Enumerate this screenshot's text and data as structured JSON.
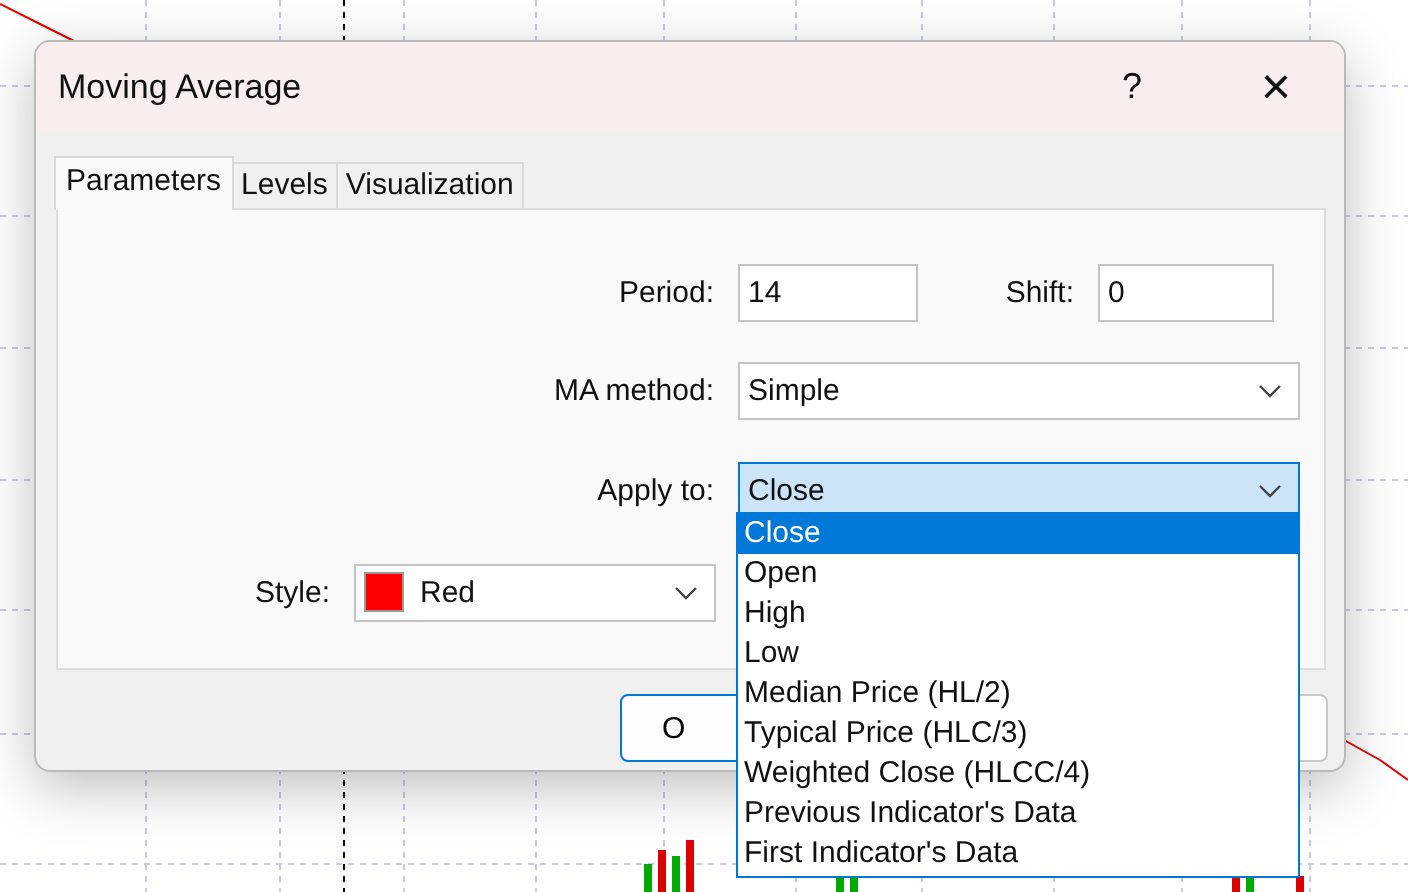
{
  "dialog": {
    "title": "Moving Average",
    "help": "?",
    "close": "×"
  },
  "tabs": [
    {
      "label": "Parameters",
      "selected": true
    },
    {
      "label": "Levels",
      "selected": false
    },
    {
      "label": "Visualization",
      "selected": false
    }
  ],
  "period": {
    "label": "Period:",
    "value": "14"
  },
  "shift": {
    "label": "Shift:",
    "value": "0"
  },
  "ma_method": {
    "label": "MA method:",
    "value": "Simple"
  },
  "apply_to": {
    "label": "Apply to:",
    "value": "Close",
    "expanded": true,
    "options": [
      {
        "label": "Close",
        "selected": true
      },
      {
        "label": "Open",
        "selected": false
      },
      {
        "label": "High",
        "selected": false
      },
      {
        "label": "Low",
        "selected": false
      },
      {
        "label": "Median Price (HL/2)",
        "selected": false
      },
      {
        "label": "Typical Price (HLC/3)",
        "selected": false
      },
      {
        "label": "Weighted Close (HLCC/4)",
        "selected": false
      },
      {
        "label": "Previous Indicator's Data",
        "selected": false
      },
      {
        "label": "First Indicator's Data",
        "selected": false
      }
    ]
  },
  "style": {
    "label": "Style:",
    "value": "Red",
    "color": "#ff0000"
  },
  "buttons": [
    {
      "label": "O"
    }
  ]
}
